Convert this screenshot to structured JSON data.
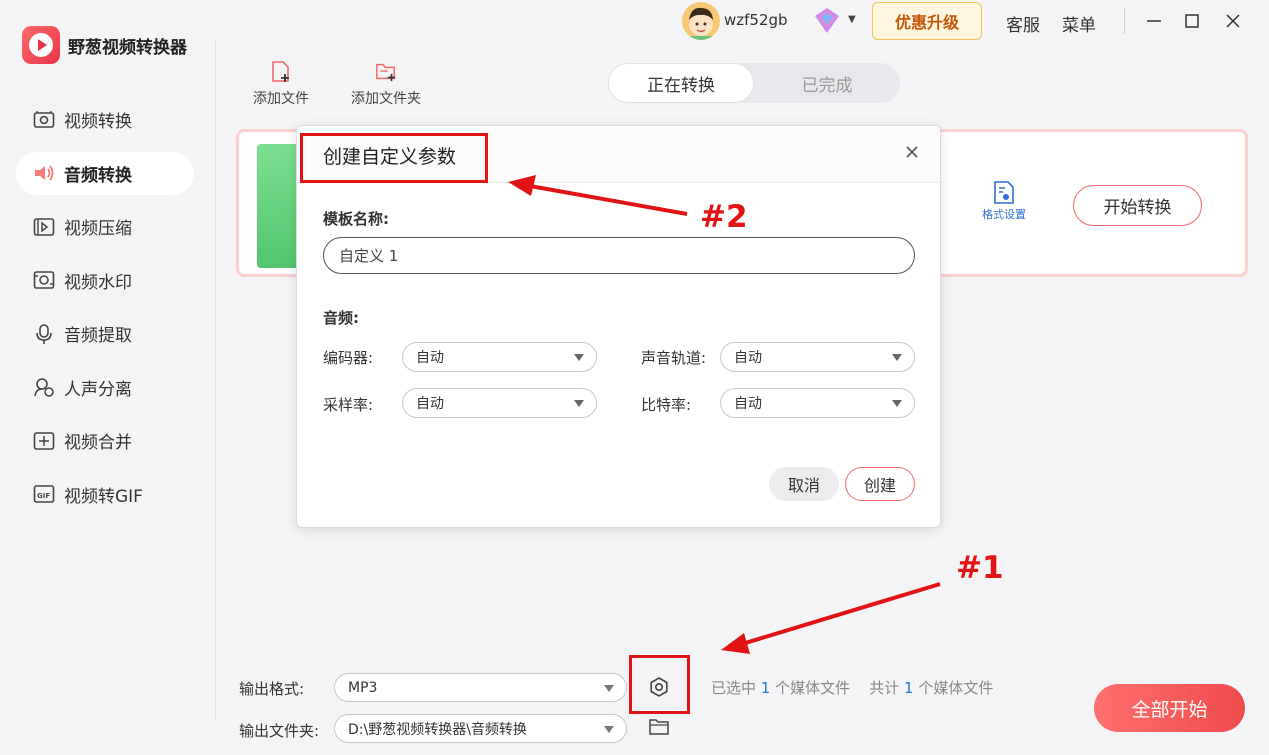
{
  "app": {
    "name": "野葱视频转换器"
  },
  "sidebar": {
    "items": [
      {
        "label": "视频转换",
        "icon": "video-convert-icon"
      },
      {
        "label": "音频转换",
        "icon": "audio-convert-icon",
        "active": true
      },
      {
        "label": "视频压缩",
        "icon": "video-compress-icon"
      },
      {
        "label": "视频水印",
        "icon": "watermark-icon"
      },
      {
        "label": "音频提取",
        "icon": "audio-extract-icon"
      },
      {
        "label": "人声分离",
        "icon": "vocal-separate-icon"
      },
      {
        "label": "视频合并",
        "icon": "video-merge-icon"
      },
      {
        "label": "视频转GIF",
        "icon": "gif-icon"
      }
    ]
  },
  "topbar": {
    "username": "wzf52gb",
    "upgrade_label": "优惠升级",
    "service_label": "客服",
    "menu_label": "菜单"
  },
  "toolbar": {
    "add_file_label": "添加文件",
    "add_folder_label": "添加文件夹"
  },
  "tabs": [
    {
      "label": "正在转换",
      "active": true
    },
    {
      "label": "已完成",
      "active": false
    }
  ],
  "file_card": {
    "format_settings_label": "格式设置",
    "start_label": "开始转换"
  },
  "dialog": {
    "title": "创建自定义参数",
    "template_name_label": "模板名称:",
    "template_name_value": "自定义 1",
    "audio_section_label": "音频:",
    "encoder_label": "编码器:",
    "encoder_value": "自动",
    "channel_label": "声音轨道:",
    "channel_value": "自动",
    "sample_rate_label": "采样率:",
    "sample_rate_value": "自动",
    "bitrate_label": "比特率:",
    "bitrate_value": "自动",
    "cancel_label": "取消",
    "create_label": "创建"
  },
  "bottom": {
    "output_format_label": "输出格式:",
    "output_format_value": "MP3",
    "output_folder_label": "输出文件夹:",
    "output_folder_value": "D:\\野葱视频转换器\\音频转换",
    "selected_prefix": "已选中",
    "selected_count": "1",
    "selected_suffix": "个媒体文件",
    "total_prefix": "共计",
    "total_count": "1",
    "total_suffix": "个媒体文件",
    "start_all_label": "全部开始"
  },
  "annotations": {
    "label_1": "#1",
    "label_2": "#2",
    "color": "#e01414"
  },
  "colors": {
    "accent": "#f04b4b",
    "link": "#2f6fd6",
    "upgrade_text": "#c4570a"
  }
}
